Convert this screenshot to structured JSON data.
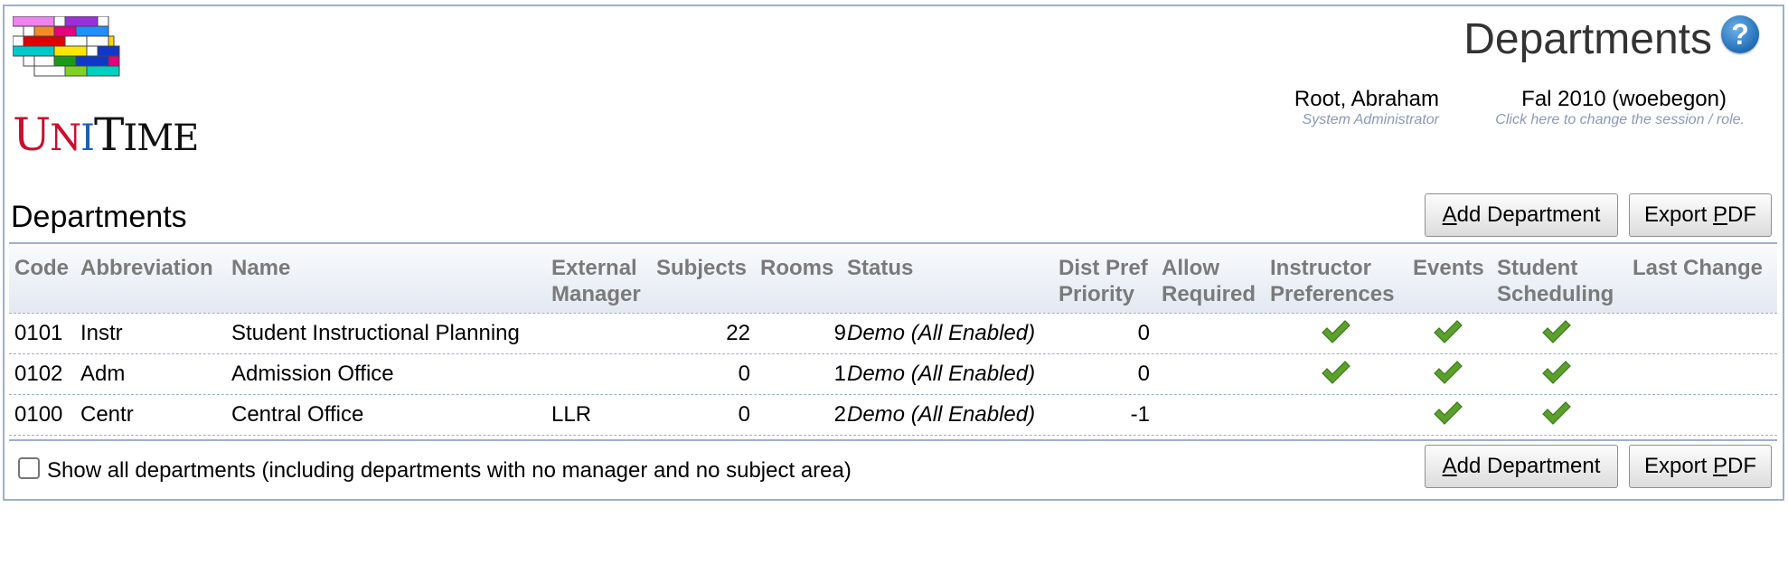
{
  "header": {
    "logo_text": "UniTime",
    "title": "Departments",
    "help_icon": "help-icon",
    "user": {
      "name": "Root, Abraham",
      "role": "System Administrator"
    },
    "session": {
      "name": "Fal 2010 (woebegon)",
      "hint": "Click here to change the session / role."
    }
  },
  "section": {
    "title": "Departments",
    "add_button": {
      "access_key": "A",
      "rest": "dd Department"
    },
    "export_button": {
      "prefix": "Export ",
      "access_key": "P",
      "rest": "DF"
    }
  },
  "table": {
    "columns": [
      {
        "l1": "Code",
        "l2": ""
      },
      {
        "l1": "Abbreviation",
        "l2": ""
      },
      {
        "l1": "Name",
        "l2": ""
      },
      {
        "l1": "External",
        "l2": "Manager"
      },
      {
        "l1": "Subjects",
        "l2": ""
      },
      {
        "l1": "Rooms",
        "l2": ""
      },
      {
        "l1": "Status",
        "l2": ""
      },
      {
        "l1": "Dist Pref",
        "l2": "Priority"
      },
      {
        "l1": "Allow",
        "l2": "Required"
      },
      {
        "l1": "Instructor",
        "l2": "Preferences"
      },
      {
        "l1": "Events",
        "l2": ""
      },
      {
        "l1": "Student",
        "l2": "Scheduling"
      },
      {
        "l1": "Last Change",
        "l2": ""
      }
    ],
    "rows": [
      {
        "code": "0101",
        "abbreviation": "Instr",
        "name": "Student Instructional Planning",
        "external_manager": "",
        "subjects": "22",
        "rooms": "9",
        "status": "Demo (All Enabled)",
        "dist_pref_priority": "0",
        "allow_required": "",
        "instructor_preferences": true,
        "events": true,
        "student_scheduling": true,
        "last_change": ""
      },
      {
        "code": "0102",
        "abbreviation": "Adm",
        "name": "Admission Office",
        "external_manager": "",
        "subjects": "0",
        "rooms": "1",
        "status": "Demo (All Enabled)",
        "dist_pref_priority": "0",
        "allow_required": "",
        "instructor_preferences": true,
        "events": true,
        "student_scheduling": true,
        "last_change": ""
      },
      {
        "code": "0100",
        "abbreviation": "Centr",
        "name": "Central Office",
        "external_manager": "LLR",
        "subjects": "0",
        "rooms": "2",
        "status": "Demo (All Enabled)",
        "dist_pref_priority": "-1",
        "allow_required": "",
        "instructor_preferences": false,
        "events": true,
        "student_scheduling": true,
        "last_change": ""
      }
    ]
  },
  "footer": {
    "show_all_label": "Show all departments (including departments with no manager and no subject area)",
    "show_all_checked": false
  },
  "colors": {
    "border": "#9cb0ce",
    "header_text": "#7a7a7a",
    "check": "#5aa02c",
    "hint": "#8a9ab8"
  }
}
